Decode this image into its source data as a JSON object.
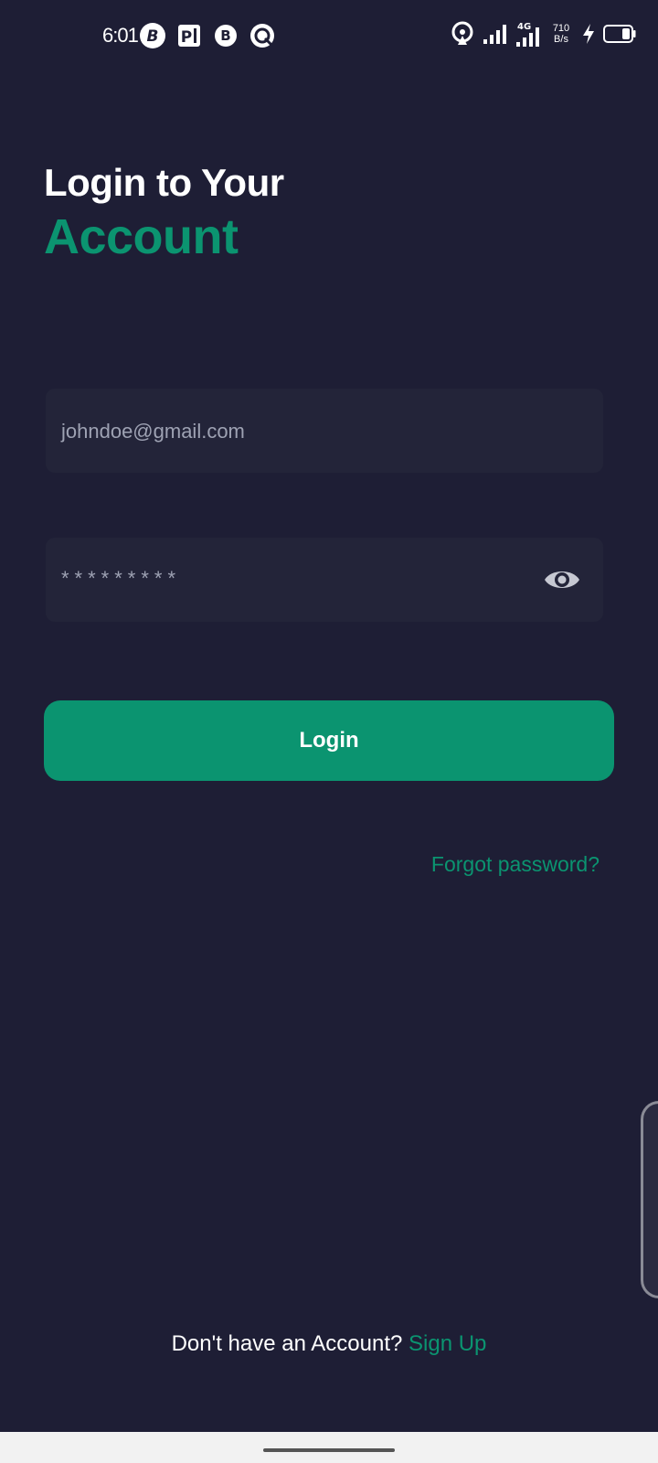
{
  "status_bar": {
    "time": "6:01",
    "network_speed_value": "710",
    "network_speed_unit": "B/s",
    "network_type": "4G",
    "notification_icons": [
      "b-app-icon",
      "p-app-icon",
      "b-app-icon",
      "q-app-icon"
    ],
    "system_icons": [
      "hotspot-icon",
      "signal-icon",
      "signal-4g-icon",
      "charging-icon",
      "battery-icon"
    ]
  },
  "header": {
    "title_line1": "Login to Your",
    "title_line2": "Account"
  },
  "form": {
    "email_value": "johndoe@gmail.com",
    "password_value": "*********",
    "login_label": "Login",
    "forgot_label": "Forgot password?"
  },
  "footer": {
    "prompt": "Don't have an Account?",
    "signup_label": "Sign Up"
  },
  "colors": {
    "background": "#1e1e35",
    "accent": "#0b9470",
    "field_bg": "#232439"
  }
}
